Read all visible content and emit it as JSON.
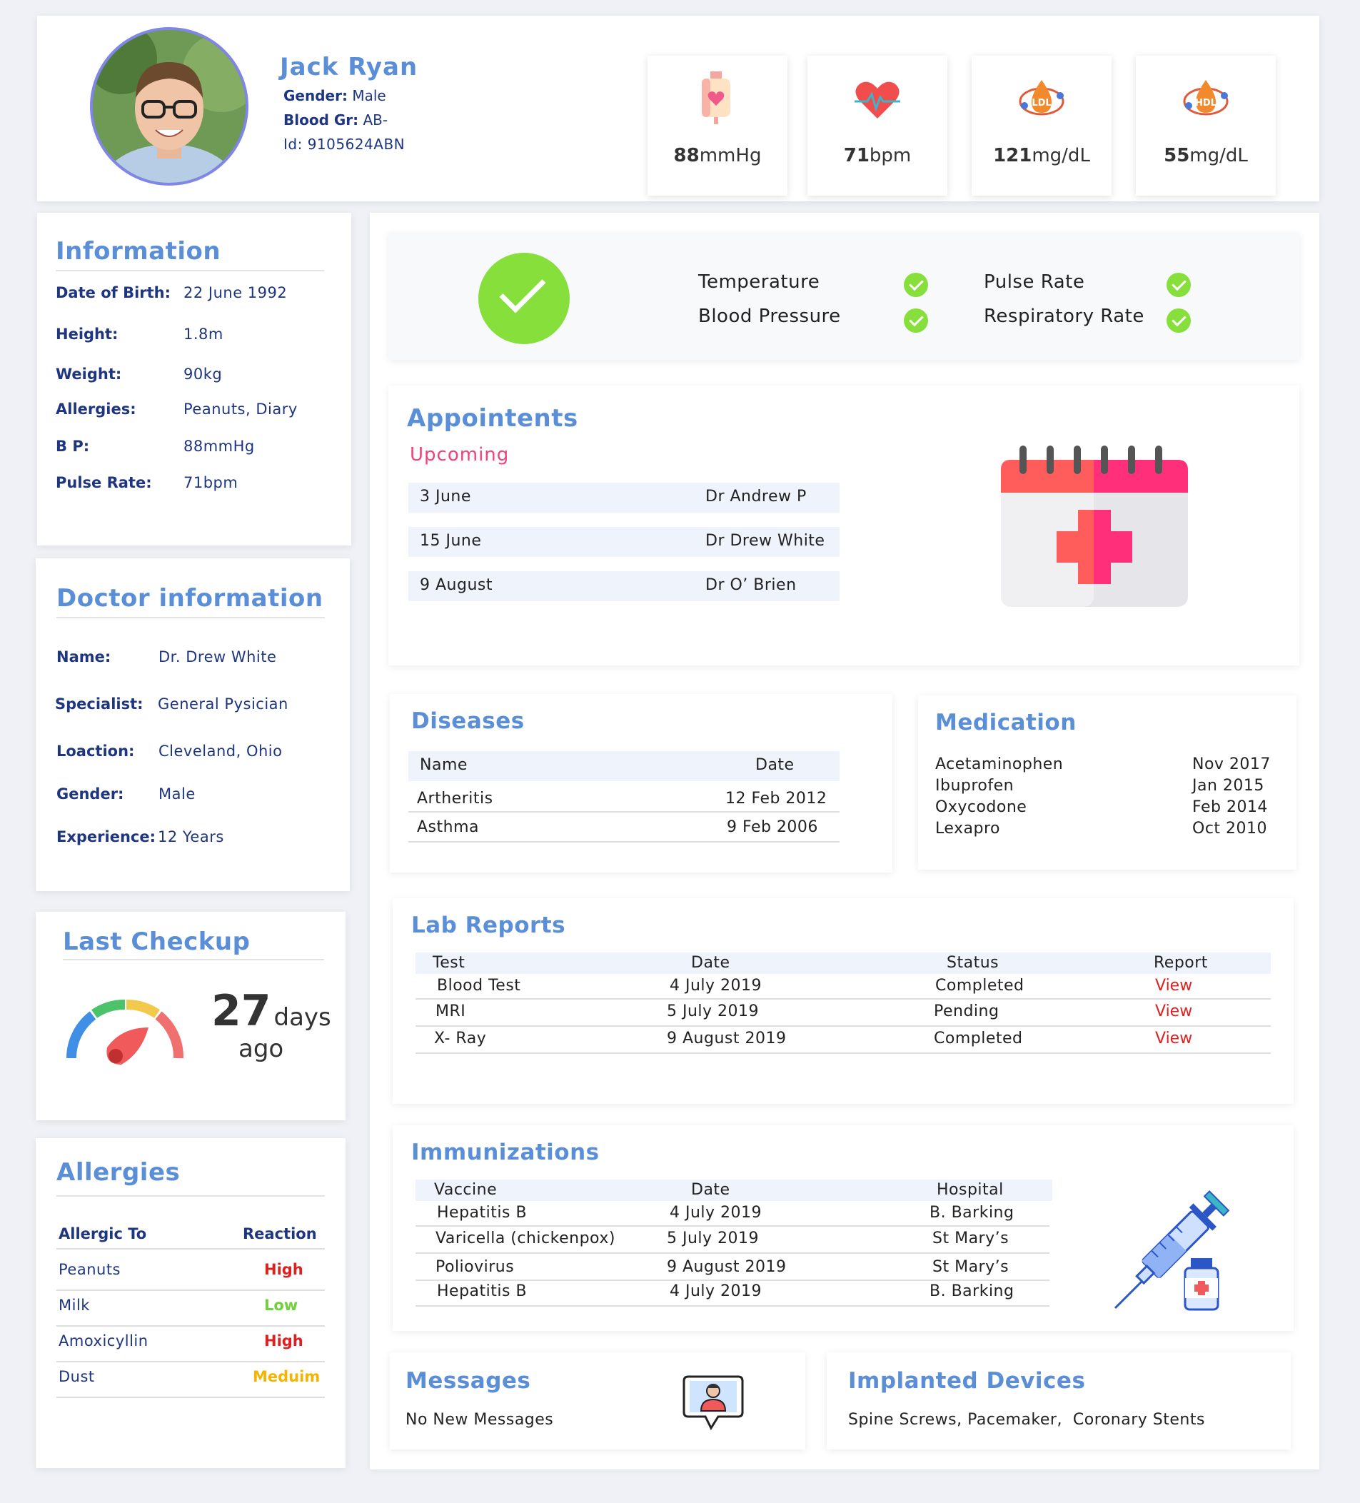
{
  "patient": {
    "name": "Jack Ryan",
    "gender_label": "Gender:",
    "gender": "Male",
    "blood_label": "Blood Gr:",
    "blood": "AB-",
    "id": "Id: 9105624ABN"
  },
  "vitals": [
    {
      "icon": "blood-bag-icon",
      "value": "88",
      "unit": "mmHg"
    },
    {
      "icon": "heart-pulse-icon",
      "value": "71",
      "unit": "bpm"
    },
    {
      "icon": "ldl-drop-icon",
      "value": "121",
      "unit": "mg/dL",
      "badge": "LDL"
    },
    {
      "icon": "hdl-drop-icon",
      "value": "55",
      "unit": "mg/dL",
      "badge": "HDL"
    }
  ],
  "information": {
    "title": "Information",
    "rows": [
      {
        "label": "Date of Birth:",
        "value": "22 June 1992"
      },
      {
        "label": "Height:",
        "value": "1.8m"
      },
      {
        "label": "Weight:",
        "value": "90kg"
      },
      {
        "label": "Allergies:",
        "value": "Peanuts, Diary"
      },
      {
        "label": "B P:",
        "value": "88mmHg"
      },
      {
        "label": "Pulse Rate:",
        "value": "71bpm"
      }
    ]
  },
  "doctor": {
    "title": "Doctor information",
    "rows": [
      {
        "label": "Name:",
        "value": "Dr. Drew White"
      },
      {
        "label": "Specialist:",
        "value": "General Pysician"
      },
      {
        "label": "Loaction:",
        "value": "Cleveland, Ohio"
      },
      {
        "label": "Gender:",
        "value": "Male"
      },
      {
        "label": "Experience:",
        "value": "12 Years"
      }
    ]
  },
  "last_checkup": {
    "title": "Last Checkup",
    "number": "27",
    "unit": "days",
    "suffix": "ago",
    "gauge_colors": [
      "#3f8fe6",
      "#4cc26b",
      "#f2c94c",
      "#f07070"
    ]
  },
  "allergies": {
    "title": "Allergies",
    "col1": "Allergic To",
    "col2": "Reaction",
    "rows": [
      {
        "name": "Peanuts",
        "reaction": "High",
        "color": "#e02020"
      },
      {
        "name": "Milk",
        "reaction": "Low",
        "color": "#6fd13b"
      },
      {
        "name": "Amoxicyllin",
        "reaction": "High",
        "color": "#e02020"
      },
      {
        "name": "Dust",
        "reaction": "Meduim",
        "color": "#f4b400"
      }
    ]
  },
  "status": {
    "items": [
      "Temperature",
      "Pulse Rate",
      "Blood Pressure",
      "Respiratory Rate"
    ],
    "ok_color": "#86df3a"
  },
  "appointments": {
    "title": "Appointents",
    "subtitle": "Upcoming",
    "rows": [
      {
        "date": "3 June",
        "doctor": "Dr Andrew P"
      },
      {
        "date": "15 June",
        "doctor": "Dr Drew White"
      },
      {
        "date": "9 August",
        "doctor": "Dr O’ Brien"
      }
    ]
  },
  "diseases": {
    "title": "Diseases",
    "col1": "Name",
    "col2": "Date",
    "rows": [
      {
        "name": "Artheritis",
        "date": "12 Feb 2012"
      },
      {
        "name": "Asthma",
        "date": "9 Feb 2006"
      }
    ]
  },
  "medication": {
    "title": "Medication",
    "rows": [
      {
        "name": "Acetaminophen",
        "date": "Nov 2017"
      },
      {
        "name": "Ibuprofen",
        "date": "Jan 2015"
      },
      {
        "name": "Oxycodone",
        "date": "Feb 2014"
      },
      {
        "name": "Lexapro",
        "date": "Oct 2010"
      }
    ]
  },
  "lab_reports": {
    "title": "Lab Reports",
    "headers": [
      "Test",
      "Date",
      "Status",
      "Report"
    ],
    "rows": [
      {
        "test": "Blood Test",
        "date": "4 July 2019",
        "status": "Completed",
        "report": "View"
      },
      {
        "test": "MRI",
        "date": "5 July 2019",
        "status": "Pending",
        "report": "View"
      },
      {
        "test": "X- Ray",
        "date": "9 August 2019",
        "status": "Completed",
        "report": "View"
      }
    ]
  },
  "immunizations": {
    "title": "Immunizations",
    "headers": [
      "Vaccine",
      "Date",
      "Hospital"
    ],
    "rows": [
      {
        "vaccine": "Hepatitis B",
        "date": "4 July 2019",
        "hospital": "B. Barking"
      },
      {
        "vaccine": "Varicella (chickenpox)",
        "date": "5 July 2019",
        "hospital": "St Mary’s"
      },
      {
        "vaccine": "Poliovirus",
        "date": "9 August 2019",
        "hospital": "St Mary’s"
      },
      {
        "vaccine": "Hepatitis B",
        "date": "4 July 2019",
        "hospital": "B. Barking"
      }
    ]
  },
  "messages": {
    "title": "Messages",
    "text": "No New Messages"
  },
  "devices": {
    "title": "Implanted Devices",
    "text": "Spine Screws, Pacemaker,  Coronary Stents"
  }
}
